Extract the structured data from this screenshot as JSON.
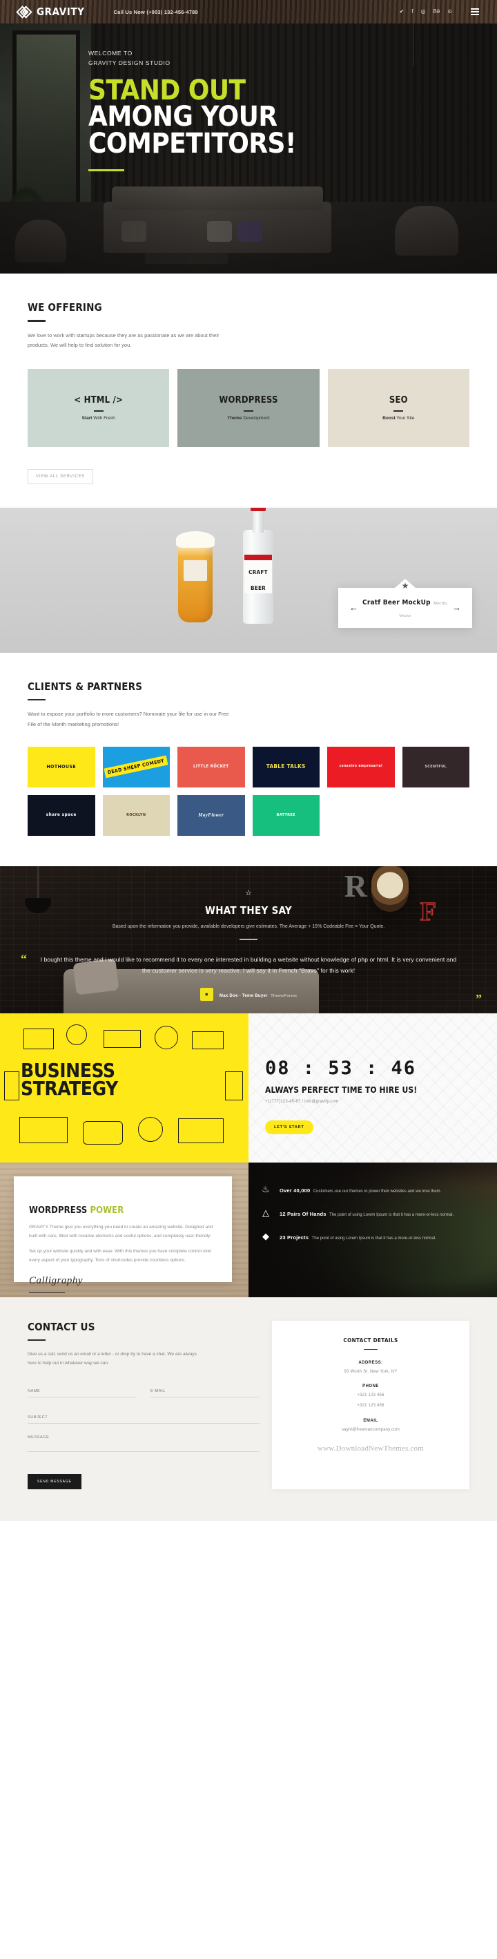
{
  "topbar": {
    "brand": "GRAVITY",
    "phone": "Call Us Now (+003) 132-456-4789",
    "social": [
      {
        "name": "twitter-icon",
        "glyph": "✔"
      },
      {
        "name": "facebook-icon",
        "glyph": "f"
      },
      {
        "name": "instagram-icon",
        "glyph": "◎"
      },
      {
        "name": "behance-icon",
        "glyph": "Bē"
      },
      {
        "name": "dribbble-icon",
        "glyph": "⊙"
      }
    ],
    "menu_label": "Menu"
  },
  "hero": {
    "welcome_line1": "WELCOME TO",
    "welcome_line2": "GRAVITY DESIGN STUDIO",
    "headline_1": "STAND OUT",
    "headline_2": "AMONG YOUR",
    "headline_3": "COMPETITORS!"
  },
  "offering": {
    "title": "WE OFFERING",
    "subtitle": "We love to work with startups because they are as passionate as we are about their products. We will help to find solution for you.",
    "cards": [
      {
        "title": "< HTML />",
        "sub_bold": "Start",
        "sub_rest": " With Fresh",
        "color": "#cbd8d1"
      },
      {
        "title": "WORDPRESS",
        "sub_bold": "Theme",
        "sub_rest": " Development",
        "color": "#9aa49e"
      },
      {
        "title": "SEO",
        "sub_bold": "Boost",
        "sub_rest": " Your Site",
        "color": "#e3ded0"
      }
    ],
    "view_all": "VIEW ALL SERVICES"
  },
  "portfolio": {
    "item_title": "Cratf Beer MockUp",
    "item_tags": "MocUp, Vector",
    "prev": "←",
    "next": "→",
    "badge": "★",
    "bottle_label_1": "CRAFT",
    "bottle_label_2": "BEER"
  },
  "clients": {
    "title": "CLIENTS & PARTNERS",
    "subtitle": "Want to expose your portfolio to more customers? Nominate your file for use in our Free File of the Month marketing promotions!",
    "logos": [
      {
        "name": "HOTHOUSE",
        "sub": "",
        "bg": "#ffe817",
        "fg": "#1d1d1d"
      },
      {
        "name": "DEAD SHEEP COMEDY",
        "sub": "",
        "bg": "#1b9fe0",
        "fg": "#111111"
      },
      {
        "name": "LITTLE RÖCKET",
        "sub": "",
        "bg": "#ea5a4c",
        "fg": "#ffffff"
      },
      {
        "name": "TABLE TALKS",
        "sub": "",
        "bg": "#0c1530",
        "fg": "#f0e24a"
      },
      {
        "name": "conexión empresarial",
        "sub": "",
        "bg": "#ec1c24",
        "fg": "#ffffff"
      },
      {
        "name": "SCENTFUL",
        "sub": "",
        "bg": "#33272a",
        "fg": "#c4433f"
      },
      {
        "name": "share space",
        "sub": "",
        "bg": "#0d1320",
        "fg": "#ffffff"
      },
      {
        "name": "ROCKLYN",
        "sub": "",
        "bg": "#ded6b5",
        "fg": "#5a3a1e"
      },
      {
        "name": "MayFlower",
        "sub": "",
        "bg": "#3a5a85",
        "fg": "#ffffff"
      },
      {
        "name": "BATTREE",
        "sub": "",
        "bg": "#16bf7e",
        "fg": "#ffffff"
      }
    ]
  },
  "testimonial": {
    "title": "WHAT THEY SAY",
    "subtitle": "Based upon the information you provide, available developers give estimates. The Average + 15% Codeable Fee = Your Quote.",
    "quote": "I bought this theme and i would like to recommend it to every one interested in building a website without knowledge of php or html. It is very convenient and the customer service is very reactive. I will say it in French \"Bravo\" for this work!",
    "author_name": "Max Doe - Teme Buyer",
    "author_role": "ThemeForest",
    "quote_open": "“",
    "quote_close": "”",
    "star": "☆"
  },
  "countdown": {
    "left_line1": "BUSINESS",
    "left_line2": "STRATEGY",
    "clock": "08 : 53 : 46",
    "tagline": "ALWAYS PERFECT TIME TO HIRE US!",
    "contact": "+1(777)123-45-67 / info@gravity.com",
    "button": "LET'S START"
  },
  "wppower": {
    "title_plain": "WORDPRESS",
    "title_accent": "POWER",
    "paragraph_1": "GRAVITY Theme give you everything you need to create an amazing website. Designed and built with care, filled with creative elements and useful options, and completely user-friendly.",
    "paragraph_2": "Set up your website quickly and with ease. With this themes you have complete control over every aspect of your typography. Tons of shortcodes provide countless options.",
    "signature": "Calligraphy",
    "stats": [
      {
        "icon": "flame-icon",
        "glyph": "♨",
        "heading": "Over 40,000",
        "text": "Customers use our themes to power their websites and we love them."
      },
      {
        "icon": "graduation-cap-icon",
        "glyph": "Ἱ3",
        "heading": "12 Pairs Of Hands",
        "text": "The point of using Lorem Ipsum is that it has a more-or-less normal."
      },
      {
        "icon": "diamond-icon",
        "glyph": "◆",
        "heading": "23 Projects",
        "text": "The point of using Lorem Ipsum is that it has a more-or-less normal."
      }
    ]
  },
  "contact": {
    "title": "CONTACT US",
    "subtitle": "Give us a call, send us an email or a letter - or drop by to have a chat. We are always here to help out in whatever way we can.",
    "fields": {
      "name_placeholder": "NAME",
      "email_placeholder": "E-MAIL",
      "subject_placeholder": "SUBJECT",
      "message_placeholder": "MESSAGE"
    },
    "send_button": "SEND MESSAGE",
    "details_title": "CONTACT DETAILS",
    "address_label": "ADDRESS:",
    "address_value": "93 Worth St, New York, NY",
    "phone_label": "PHONE",
    "phone_value_1": "+321 123 456",
    "phone_value_2": "+321 123 456",
    "email_label": "EMAIL",
    "email_value": "sayhi@freemancompany.com",
    "watermark": "www.DownloadNewThemes.com"
  }
}
